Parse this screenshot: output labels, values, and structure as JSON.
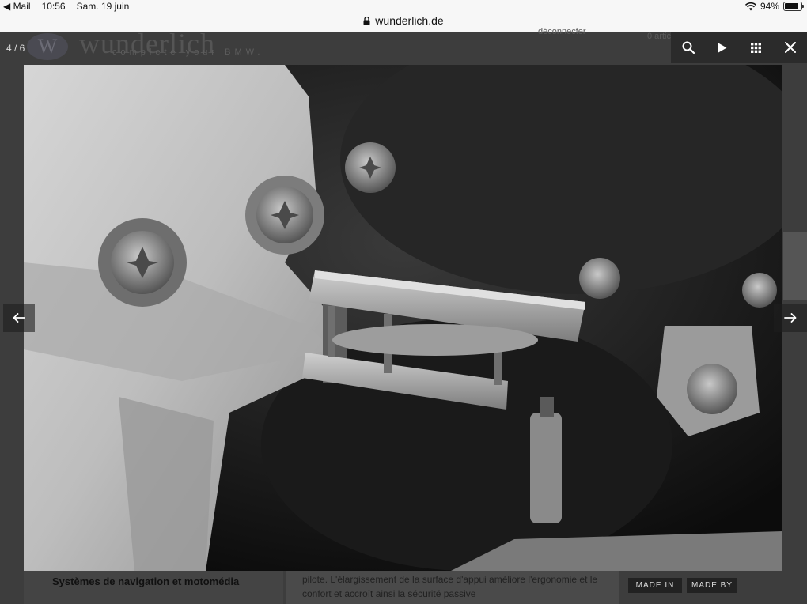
{
  "status_bar": {
    "back_app": "◀ Mail",
    "time": "10:56",
    "date": "Sam. 19 juin",
    "battery": "94%",
    "battery_level": 0.94
  },
  "url_bar": {
    "domain": "wunderlich.de"
  },
  "site_background": {
    "logo_name": "wunderlich",
    "logo_tagline": "complete your BMW.",
    "header_link": "déconnecter",
    "cart_text": "0 artic",
    "sidebar_nav_item": "Systèmes de navigation et motomédia",
    "description_text": "pilote. L'élargissement de la surface d'appui améliore l'ergonomie et le confort et accroît ainsi la sécurité passive",
    "badge_made_in": "MADE IN",
    "badge_made_by": "MADE BY"
  },
  "lightbox": {
    "counter": "4 / 6",
    "toolbar_icons": [
      "search-icon",
      "play-icon",
      "grid-icon",
      "close-icon"
    ],
    "prev_icon": "arrow-left-icon",
    "next_icon": "arrow-right-icon"
  },
  "colors": {
    "overlay": "#3d3d3d",
    "status_bar_bg": "#f7f7f7",
    "icon_white": "#ffffff"
  }
}
